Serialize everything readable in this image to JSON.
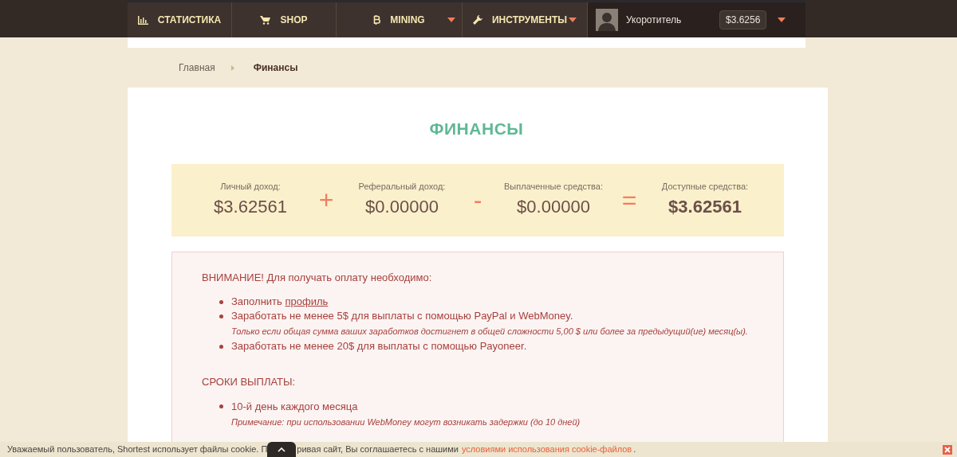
{
  "nav": {
    "items": [
      {
        "label": "СТАТИСТИКА",
        "kind": "stats",
        "dropdown": false
      },
      {
        "label": "SHOP",
        "kind": "cart",
        "dropdown": false
      },
      {
        "label": "MINING",
        "kind": "bitcoin",
        "dropdown": true
      },
      {
        "label": "ИНСТРУМЕНТЫ",
        "kind": "wrench",
        "dropdown": true
      }
    ],
    "user": {
      "name": "Укоротитель",
      "balance": "$3.6256"
    }
  },
  "breadcrumbs": [
    {
      "label": "Главная",
      "current": false
    },
    {
      "label": "Финансы",
      "current": true
    }
  ],
  "title": "ФИНАНСЫ",
  "summary": [
    {
      "label": "Личный доход:",
      "value": "$3.62561",
      "bold": false,
      "operator": "+"
    },
    {
      "label": "Реферальный доход:",
      "value": "$0.00000",
      "bold": false,
      "operator": "-"
    },
    {
      "label": "Выплаченные средства:",
      "value": "$0.00000",
      "bold": false,
      "operator": "="
    },
    {
      "label": "Доступные средства:",
      "value": "$3.62561",
      "bold": true
    }
  ],
  "notice": {
    "sections": [
      {
        "heading": "ВНИМАНИЕ! Для получать оплату необходимо:",
        "items": [
          {
            "text": "Заполнить ",
            "link": "профиль"
          },
          {
            "text": "Заработать не менее 5$ для выплаты с помощью PayPal и WebMoney.",
            "note": "Только если общая сумма ваших заработков достигнет в общей сложности 5,00 $ или более за предыдущий(ие) месяц(ы)."
          },
          {
            "text": "Заработать не менее 20$ для выплаты с помощью Payoneer."
          }
        ]
      },
      {
        "heading": "СРОКИ ВЫПЛАТЫ:",
        "items": [
          {
            "text": "10-й день каждого месяца",
            "note": "Примечание: при использовании WebMoney могут возникать задержки (до 10 дней)"
          }
        ]
      }
    ]
  },
  "cookie_bar": {
    "text_before": "Уважаемый пользователь, Shortest использует файлы cookie. П",
    "text_after": "ривая сайт, Вы соглашаетесь с нашими",
    "link": "условиями использования cookie-файлов",
    "end": "."
  }
}
